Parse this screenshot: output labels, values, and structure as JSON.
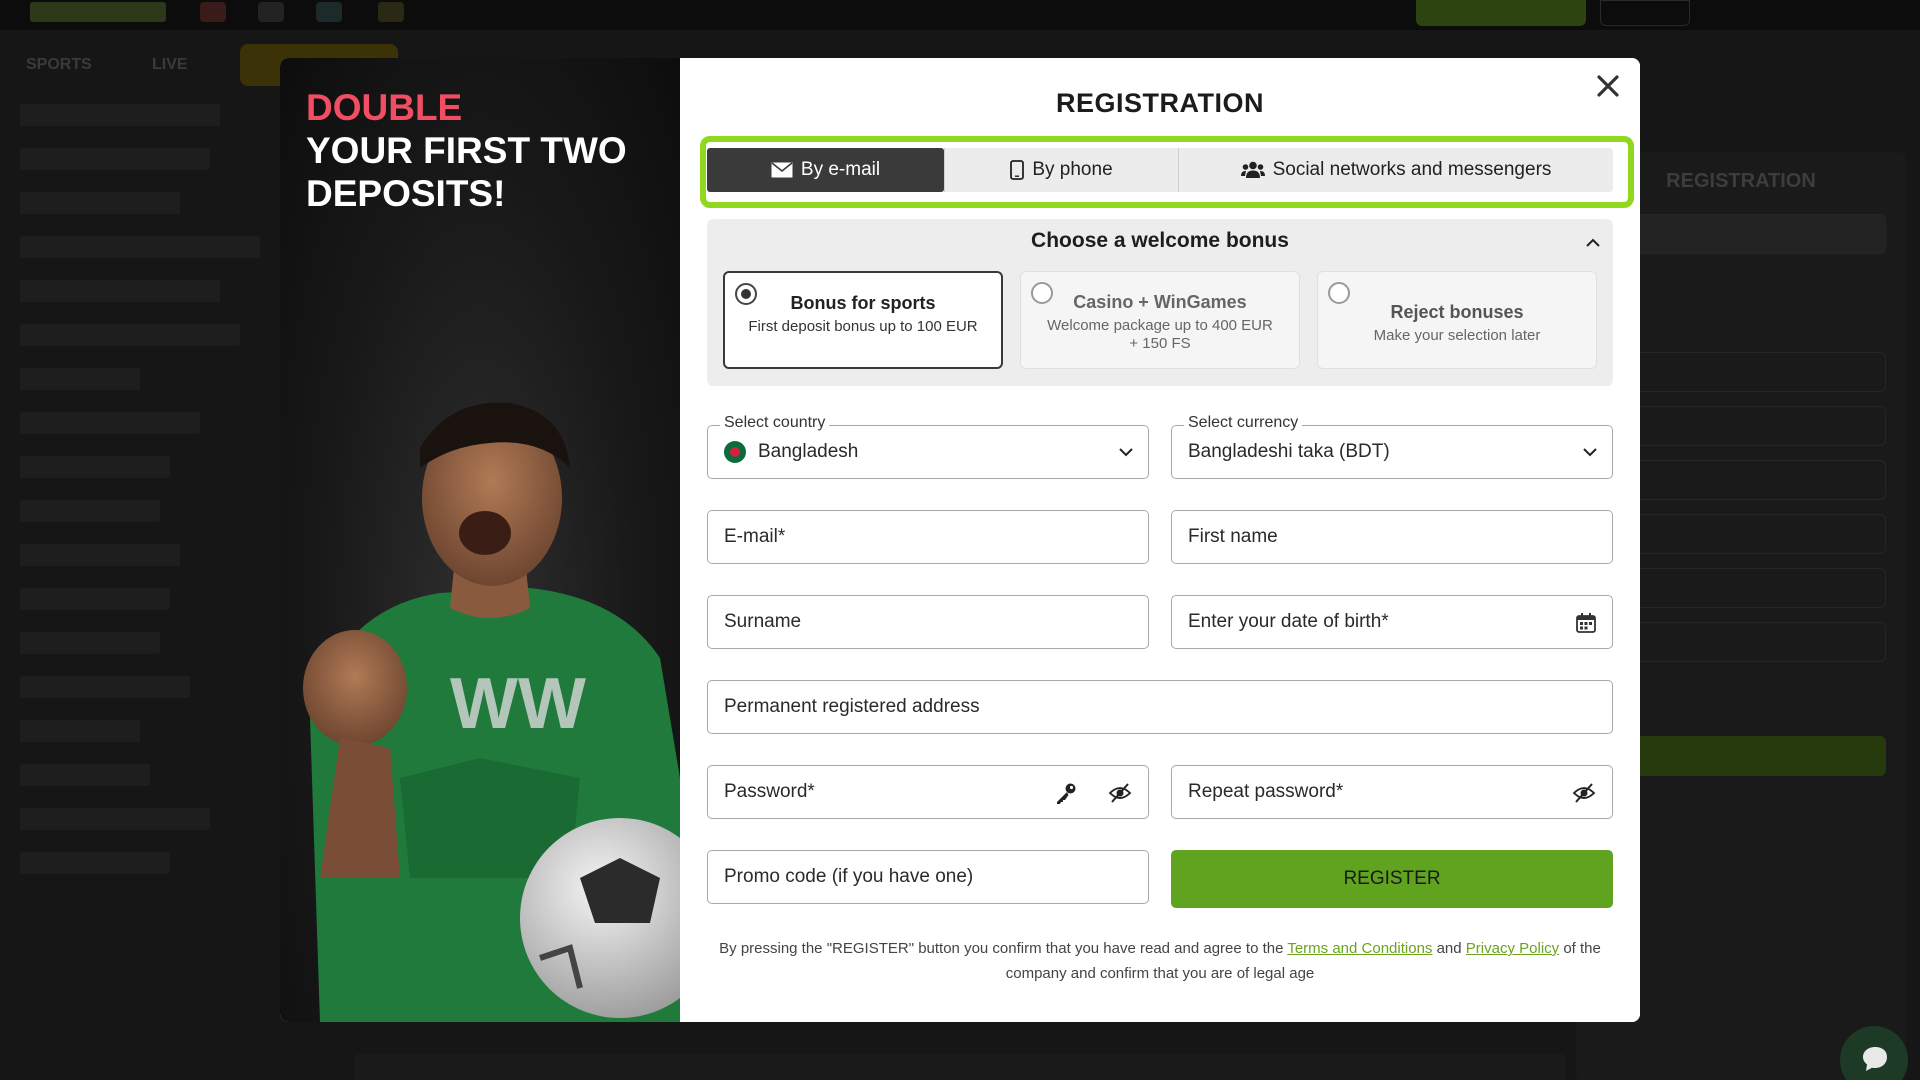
{
  "background": {
    "nav": [
      "SPORTS",
      "LIVE"
    ],
    "right_panel_title": "REGISTRATION"
  },
  "promo": {
    "title_accent": "DOUBLE",
    "title_rest": "YOUR FIRST TWO DEPOSITS!"
  },
  "modal": {
    "title": "REGISTRATION",
    "tabs": [
      {
        "label": "By e-mail",
        "icon": "envelope-icon",
        "active": true
      },
      {
        "label": "By phone",
        "icon": "phone-icon",
        "active": false
      },
      {
        "label": "Social networks and messengers",
        "icon": "users-icon",
        "active": false
      }
    ],
    "bonus": {
      "heading": "Choose a welcome bonus",
      "options": [
        {
          "title": "Bonus for sports",
          "subtitle": "First deposit bonus up to 100 EUR",
          "selected": true
        },
        {
          "title": "Casino + WinGames",
          "subtitle": "Welcome package up to 400 EUR + 150 FS",
          "selected": false
        },
        {
          "title": "Reject bonuses",
          "subtitle": "Make your selection later",
          "selected": false
        }
      ]
    },
    "form": {
      "country_label": "Select country",
      "country_value": "Bangladesh",
      "currency_label": "Select currency",
      "currency_value": "Bangladeshi taka (BDT)",
      "email_placeholder": "E-mail*",
      "first_name_placeholder": "First name",
      "surname_placeholder": "Surname",
      "dob_placeholder": "Enter your date of birth*",
      "address_placeholder": "Permanent registered address",
      "password_placeholder": "Password*",
      "repeat_password_placeholder": "Repeat password*",
      "promo_placeholder": "Promo code (if you have one)",
      "register_label": "REGISTER"
    },
    "legal": {
      "text_1": "By pressing the \"REGISTER\" button you confirm that you have read and agree to the ",
      "terms_link": "Terms and Conditions",
      "text_2": " and ",
      "privacy_link": "Privacy Policy",
      "text_3": " of the company and confirm that you are of legal age"
    }
  },
  "colors": {
    "accent_green": "#90d81d",
    "register_green": "#5fa31e",
    "promo_pink": "#f14e63",
    "active_tab": "#3a3a3a"
  }
}
